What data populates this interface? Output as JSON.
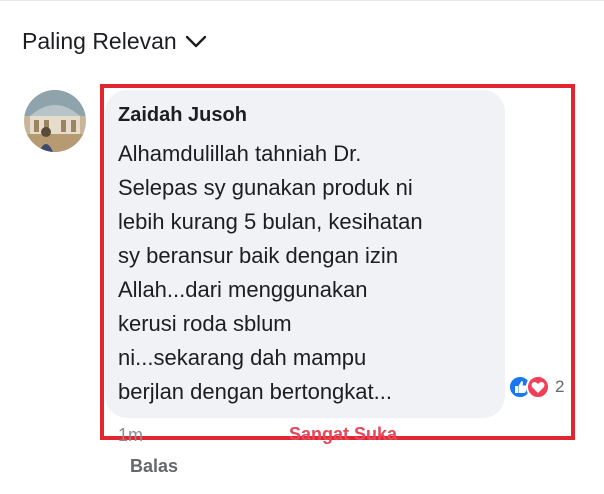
{
  "sort_menu": {
    "label": "Paling Relevan",
    "icon": "chevron-down-icon"
  },
  "comment": {
    "author": "Zaidah Jusoh",
    "avatar_icon": "profile-photo",
    "lines": [
      "Alhamdulillah tahniah Dr.",
      "Selepas sy gunakan produk ni",
      "lebih kurang 5 bulan, kesihatan",
      "sy beransur baik dengan izin",
      "Allah...dari menggunakan",
      "kerusi roda sblum",
      "ni...sekarang dah mampu",
      "berjlan dengan bertongkat..."
    ],
    "reactions": {
      "icons": [
        "like-icon",
        "love-icon"
      ],
      "count": "2"
    },
    "time": "1m",
    "reacted_label": "Sangat Suka",
    "reply_label": "Balas"
  },
  "colors": {
    "highlight_frame": "#e1262f",
    "bubble": "#f0f2f5",
    "like": "#1877f2",
    "love": "#f33e58",
    "reacted_text": "#e8465a"
  }
}
